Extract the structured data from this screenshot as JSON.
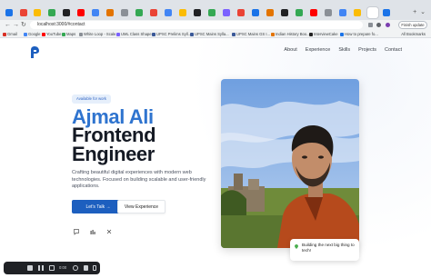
{
  "browser": {
    "url": "localhost:3000/#contact",
    "finish_update": "Finish update",
    "all_bookmarks": "All Bookmarks",
    "bookmarks": [
      {
        "label": "Gmail",
        "color": "#d93025"
      },
      {
        "label": "Google",
        "color": "#4285f4"
      },
      {
        "label": "YouTube",
        "color": "#ff0000"
      },
      {
        "label": "Maps",
        "color": "#34a853"
      },
      {
        "label": "White Loop - Scale...",
        "color": "#8a8f96"
      },
      {
        "label": "UML Class Shape...",
        "color": "#7b61ff"
      },
      {
        "label": "UPSC Prelims Syll...",
        "color": "#3b5998"
      },
      {
        "label": "UPSC Mains Sylla...",
        "color": "#3b5998"
      },
      {
        "label": "UPSC Mains GS I...",
        "color": "#3b5998"
      },
      {
        "label": "Indian History Boo...",
        "color": "#e37400"
      },
      {
        "label": "InterviewCake",
        "color": "#222222"
      },
      {
        "label": "How to prepare fo...",
        "color": "#1a73e8"
      }
    ]
  },
  "site": {
    "nav": [
      "About",
      "Experience",
      "Skills",
      "Projects",
      "Contact"
    ],
    "badge": "Available for work",
    "name": "Ajmal Ali",
    "role": "Frontend Engineer",
    "description": "Crafting beautiful digital experiences with modern web technologies. Focused on building scalable and user-friendly applications.",
    "cta_primary": "Let's Talk →",
    "cta_secondary": "View Experience",
    "socials": [
      "github-icon",
      "linkedin-icon",
      "x-icon"
    ],
    "callout": "Building the next big thing to tech!",
    "accent": "#2f74cf",
    "button_color": "#1d5fbf"
  },
  "recorder": {
    "time": "0:00"
  }
}
